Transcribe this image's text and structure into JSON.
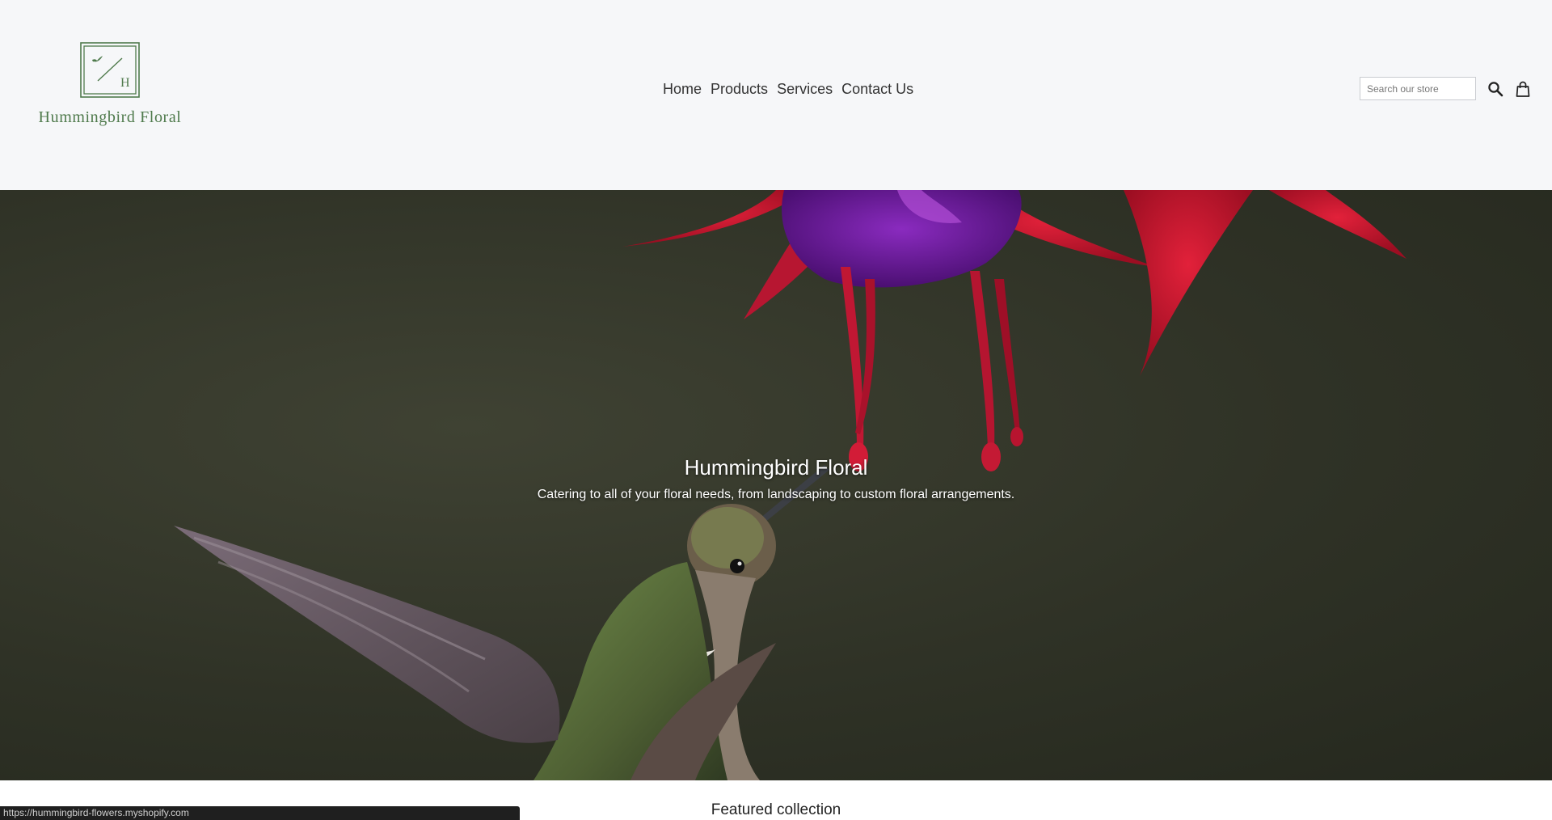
{
  "header": {
    "logo_text": "Hummingbird Floral",
    "logo_monogram": "H",
    "nav": [
      {
        "label": "Home"
      },
      {
        "label": "Products"
      },
      {
        "label": "Services"
      },
      {
        "label": "Contact Us"
      }
    ],
    "search": {
      "placeholder": "Search our store",
      "value": ""
    },
    "icons": {
      "search": "search-icon",
      "cart": "shopping-bag-icon"
    },
    "brand_color": "#4f7a4c"
  },
  "hero": {
    "title": "Hummingbird Floral",
    "subtitle": "Catering to all of your floral needs, from landscaping to custom floral arrangements."
  },
  "featured": {
    "title": "Featured collection"
  },
  "status_bar": {
    "url": "https://hummingbird-flowers.myshopify.com"
  }
}
